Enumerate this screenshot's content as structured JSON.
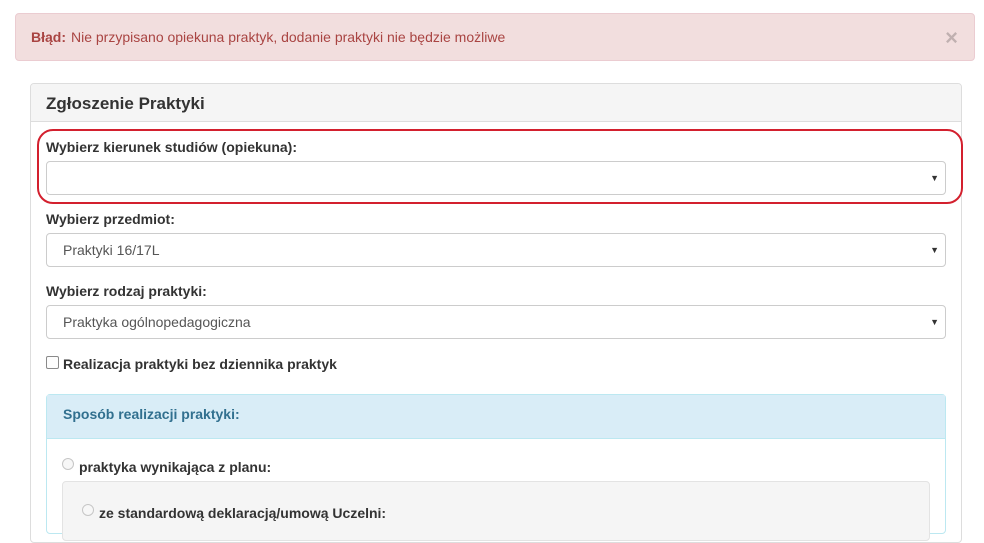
{
  "alert": {
    "prefix": "Błąd:",
    "message": "Nie przypisano opiekuna praktyk, dodanie praktyki nie będzie możliwe",
    "close_icon": "×"
  },
  "panel": {
    "title": "Zgłoszenie Praktyki"
  },
  "form": {
    "kierunek_label": "Wybierz kierunek studiów (opiekuna):",
    "kierunek_value": "",
    "przedmiot_label": "Wybierz przedmiot:",
    "przedmiot_value": "Praktyki 16/17L",
    "rodzaj_label": "Wybierz rodzaj praktyki:",
    "rodzaj_value": "Praktyka ogólnopedagogiczna",
    "caret": "▼",
    "bez_dziennika_label": "Realizacja praktyki bez dziennika praktyk"
  },
  "sposob": {
    "heading": "Sposób realizacji praktyki:",
    "option_plan": "praktyka wynikająca z planu:",
    "option_standard": "ze standardową deklaracją/umową Uczelni:"
  },
  "colors": {
    "alert_bg": "#f2dede",
    "alert_text": "#a94442",
    "highlight_outline": "#d3202e",
    "info_bg": "#d9edf7",
    "info_text": "#31708f"
  }
}
